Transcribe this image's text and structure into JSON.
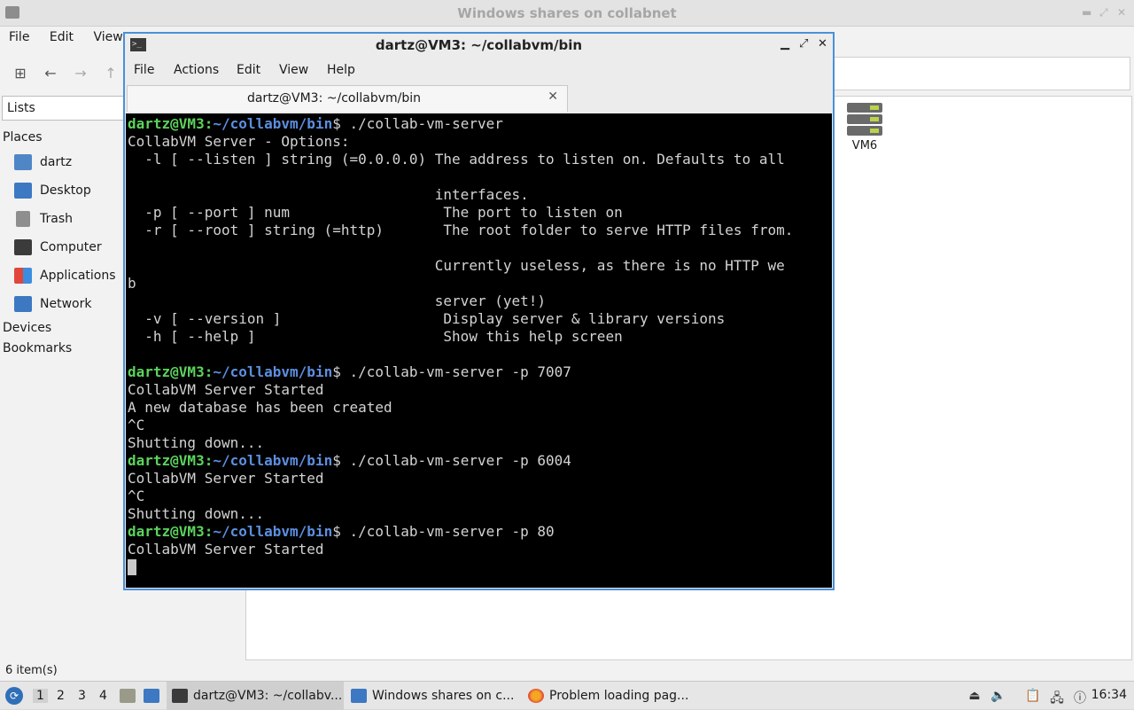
{
  "file_manager": {
    "title": "Windows shares on collabnet",
    "menu": [
      "File",
      "Edit",
      "View"
    ],
    "sidebar": {
      "lists_label": "Lists",
      "places_heading": "Places",
      "places": [
        {
          "label": "dartz",
          "icon": "home-folder-icon"
        },
        {
          "label": "Desktop",
          "icon": "desktop-folder-icon"
        },
        {
          "label": "Trash",
          "icon": "trash-icon"
        },
        {
          "label": "Computer",
          "icon": "computer-icon"
        },
        {
          "label": "Applications",
          "icon": "applications-icon"
        },
        {
          "label": "Network",
          "icon": "network-icon"
        }
      ],
      "devices_heading": "Devices",
      "bookmarks_heading": "Bookmarks"
    },
    "items": [
      {
        "label": "VM6",
        "icon": "server-icon"
      }
    ],
    "status": "6 item(s)"
  },
  "terminal": {
    "title": "dartz@VM3: ~/collabvm/bin",
    "menu": [
      "File",
      "Actions",
      "Edit",
      "View",
      "Help"
    ],
    "tab_label": "dartz@VM3: ~/collabvm/bin",
    "prompt_user": "dartz@VM3",
    "prompt_colon": ":",
    "prompt_path": "~/collabvm/bin",
    "prompt_sign": "$",
    "lines": [
      {
        "type": "cmd",
        "text": " ./collab-vm-server"
      },
      {
        "type": "out",
        "text": "CollabVM Server - Options:"
      },
      {
        "type": "out",
        "text": "  -l [ --listen ] string (=0.0.0.0) The address to listen on. Defaults to all"
      },
      {
        "type": "out",
        "text": ""
      },
      {
        "type": "out",
        "text": "                                    interfaces."
      },
      {
        "type": "out",
        "text": "  -p [ --port ] num                  The port to listen on"
      },
      {
        "type": "out",
        "text": "  -r [ --root ] string (=http)       The root folder to serve HTTP files from."
      },
      {
        "type": "out",
        "text": ""
      },
      {
        "type": "out",
        "text": "                                    Currently useless, as there is no HTTP we"
      },
      {
        "type": "out",
        "text": "b"
      },
      {
        "type": "out",
        "text": "                                    server (yet!)"
      },
      {
        "type": "out",
        "text": "  -v [ --version ]                   Display server & library versions"
      },
      {
        "type": "out",
        "text": "  -h [ --help ]                      Show this help screen"
      },
      {
        "type": "out",
        "text": ""
      },
      {
        "type": "cmd",
        "text": " ./collab-vm-server -p 7007"
      },
      {
        "type": "out",
        "text": "CollabVM Server Started"
      },
      {
        "type": "out",
        "text": "A new database has been created"
      },
      {
        "type": "out",
        "text": "^C"
      },
      {
        "type": "out",
        "text": "Shutting down..."
      },
      {
        "type": "cmd",
        "text": " ./collab-vm-server -p 6004"
      },
      {
        "type": "out",
        "text": "CollabVM Server Started"
      },
      {
        "type": "out",
        "text": "^C"
      },
      {
        "type": "out",
        "text": "Shutting down..."
      },
      {
        "type": "cmd",
        "text": " ./collab-vm-server -p 80"
      },
      {
        "type": "out",
        "text": "CollabVM Server Started"
      },
      {
        "type": "cursor",
        "text": ""
      }
    ]
  },
  "taskbar": {
    "workspaces": [
      "1",
      "2",
      "3",
      "4"
    ],
    "active_workspace": "1",
    "tasks": [
      {
        "label": "dartz@VM3: ~/collabv...",
        "icon": "terminal-icon"
      },
      {
        "label": "Windows shares on c...",
        "icon": "folder-icon"
      },
      {
        "label": "Problem loading pag...",
        "icon": "firefox-icon"
      }
    ],
    "clock": "16:34"
  },
  "colors": {
    "accent": "#4a90d9",
    "prompt_user": "#5cd35c",
    "prompt_path": "#5c8fe0",
    "terminal_bg": "#000000"
  }
}
